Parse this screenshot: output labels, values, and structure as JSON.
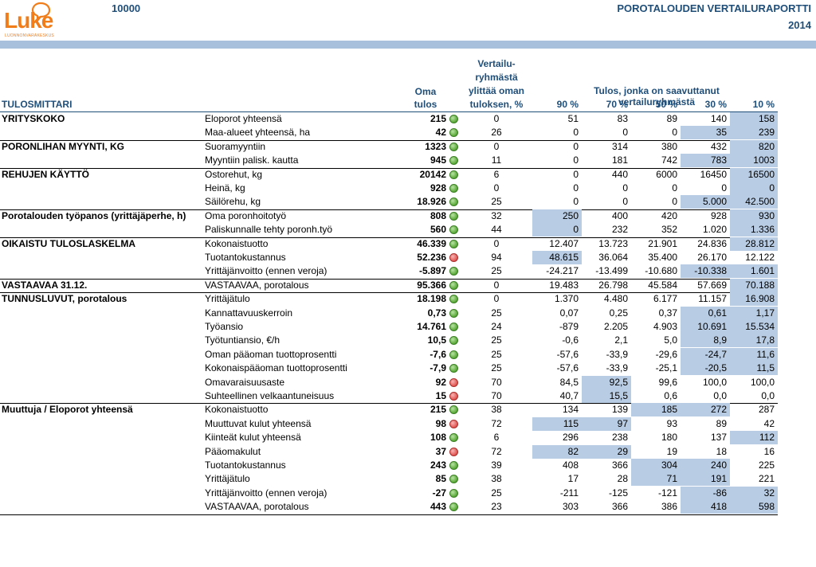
{
  "header": {
    "logo_text": "Luke",
    "logo_sub": "LUONNONVARAKESKUS",
    "report_id": "10000",
    "report_title": "POROTALOUDEN VERTAILURAPORTTI",
    "report_year": "2014"
  },
  "colors": {
    "header_text": "#1f4e79",
    "band": "#a8c0dc",
    "highlight": "#b8cce4",
    "good": "#57a836",
    "bad": "#e2534f",
    "logo": "#f07d1a"
  },
  "columns": {
    "tulosmittari": "TULOSMITTARI",
    "oma_line1": "Oma",
    "oma_line2": "tulos",
    "vert_line1": "Vertailu-",
    "vert_line2": "ryhmästä",
    "vert_line3": "ylittää oman",
    "vert_line4": "tuloksen, %",
    "tulos_group": "Tulos, jonka on saavuttanut vertailuryhmästä",
    "pcts": [
      "90 %",
      "70 %",
      "50 %",
      "30 %",
      "10 %"
    ]
  },
  "rows": [
    {
      "cat": "YRITYSKOKO",
      "name": "Eloporot yhteensä",
      "oma": "215",
      "dot": "green",
      "pct": "0",
      "vals": [
        "51",
        "83",
        "89",
        "140",
        "158"
      ],
      "hl": [
        0,
        0,
        0,
        0,
        1
      ],
      "sep": false
    },
    {
      "cat": "",
      "name": "Maa-alueet yhteensä, ha",
      "oma": "42",
      "dot": "green",
      "pct": "26",
      "vals": [
        "0",
        "0",
        "0",
        "35",
        "239"
      ],
      "hl": [
        0,
        0,
        0,
        1,
        1
      ],
      "sep": true
    },
    {
      "cat": "PORONLIHAN MYYNTI, KG",
      "name": "Suoramyyntiin",
      "oma": "1323",
      "dot": "green",
      "pct": "0",
      "vals": [
        "0",
        "314",
        "380",
        "432",
        "820"
      ],
      "hl": [
        0,
        0,
        0,
        0,
        1
      ],
      "sep": false
    },
    {
      "cat": "",
      "name": "Myyntiin palisk. kautta",
      "oma": "945",
      "dot": "green",
      "pct": "11",
      "vals": [
        "0",
        "181",
        "742",
        "783",
        "1003"
      ],
      "hl": [
        0,
        0,
        0,
        1,
        1
      ],
      "sep": true
    },
    {
      "cat": "REHUJEN KÄYTTÖ",
      "name": "Ostorehut, kg",
      "oma": "20142",
      "dot": "green",
      "pct": "6",
      "vals": [
        "0",
        "440",
        "6000",
        "16450",
        "16500"
      ],
      "hl": [
        0,
        0,
        0,
        0,
        1
      ],
      "sep": false
    },
    {
      "cat": "",
      "name": "Heinä, kg",
      "oma": "928",
      "dot": "green",
      "pct": "0",
      "vals": [
        "0",
        "0",
        "0",
        "0",
        "0"
      ],
      "hl": [
        0,
        0,
        0,
        0,
        1
      ],
      "sep": false
    },
    {
      "cat": "",
      "name": "Säilörehu, kg",
      "oma": "18.926",
      "dot": "green",
      "pct": "25",
      "vals": [
        "0",
        "0",
        "0",
        "5.000",
        "42.500"
      ],
      "hl": [
        0,
        0,
        0,
        1,
        1
      ],
      "sep": true
    },
    {
      "cat": "Porotalouden työpanos (yrittäjäperhe, h)",
      "name": "Oma poronhoitotyö",
      "oma": "808",
      "dot": "green",
      "pct": "32",
      "vals": [
        "250",
        "400",
        "420",
        "928",
        "930"
      ],
      "hl": [
        1,
        0,
        0,
        0,
        1
      ],
      "sep": false
    },
    {
      "cat": "",
      "name": "Paliskunnalle tehty poronh.työ",
      "oma": "560",
      "dot": "green",
      "pct": "44",
      "vals": [
        "0",
        "232",
        "352",
        "1.020",
        "1.336"
      ],
      "hl": [
        1,
        0,
        0,
        0,
        1
      ],
      "sep": true
    },
    {
      "cat": "OIKAISTU TULOSLASKELMA",
      "name": "Kokonaistuotto",
      "oma": "46.339",
      "dot": "green",
      "pct": "0",
      "vals": [
        "12.407",
        "13.723",
        "21.901",
        "24.836",
        "28.812"
      ],
      "hl": [
        0,
        0,
        0,
        0,
        1
      ],
      "sep": false
    },
    {
      "cat": "",
      "name": "Tuotantokustannus",
      "oma": "52.236",
      "dot": "red",
      "pct": "94",
      "vals": [
        "48.615",
        "36.064",
        "35.400",
        "26.170",
        "12.122"
      ],
      "hl": [
        1,
        0,
        0,
        0,
        0
      ],
      "sep": false
    },
    {
      "cat": "",
      "name": "Yrittäjänvoitto (ennen veroja)",
      "oma": "-5.897",
      "dot": "green",
      "pct": "25",
      "vals": [
        "-24.217",
        "-13.499",
        "-10.680",
        "-10.338",
        "1.601"
      ],
      "hl": [
        0,
        0,
        0,
        1,
        1
      ],
      "sep": true
    },
    {
      "cat": "VASTAAVAA 31.12.",
      "name": "VASTAAVAA, porotalous",
      "oma": "95.366",
      "dot": "green",
      "pct": "0",
      "vals": [
        "19.483",
        "26.798",
        "45.584",
        "57.669",
        "70.188"
      ],
      "hl": [
        0,
        0,
        0,
        0,
        1
      ],
      "sep": true
    },
    {
      "cat": "TUNNUSLUVUT, porotalous",
      "name": "Yrittäjätulo",
      "oma": "18.198",
      "dot": "green",
      "pct": "0",
      "vals": [
        "1.370",
        "4.480",
        "6.177",
        "11.157",
        "16.908"
      ],
      "hl": [
        0,
        0,
        0,
        0,
        1
      ],
      "sep": false
    },
    {
      "cat": "",
      "name": "Kannattavuuskerroin",
      "oma": "0,73",
      "dot": "green",
      "pct": "25",
      "vals": [
        "0,07",
        "0,25",
        "0,37",
        "0,61",
        "1,17"
      ],
      "hl": [
        0,
        0,
        0,
        1,
        1
      ],
      "sep": false
    },
    {
      "cat": "",
      "name": "Työansio",
      "oma": "14.761",
      "dot": "green",
      "pct": "24",
      "vals": [
        "-879",
        "2.205",
        "4.903",
        "10.691",
        "15.534"
      ],
      "hl": [
        0,
        0,
        0,
        1,
        1
      ],
      "sep": false
    },
    {
      "cat": "",
      "name": "Työtuntiansio, €/h",
      "oma": "10,5",
      "dot": "green",
      "pct": "25",
      "vals": [
        "-0,6",
        "2,1",
        "5,0",
        "8,9",
        "17,8"
      ],
      "hl": [
        0,
        0,
        0,
        1,
        1
      ],
      "sep": false
    },
    {
      "cat": "",
      "name": "Oman pääoman tuottoprosentti",
      "oma": "-7,6",
      "dot": "green",
      "pct": "25",
      "vals": [
        "-57,6",
        "-33,9",
        "-29,6",
        "-24,7",
        "11,6"
      ],
      "hl": [
        0,
        0,
        0,
        1,
        1
      ],
      "sep": false
    },
    {
      "cat": "",
      "name": "Kokonaispääoman tuottoprosentti",
      "oma": "-7,9",
      "dot": "green",
      "pct": "25",
      "vals": [
        "-57,6",
        "-33,9",
        "-25,1",
        "-20,5",
        "11,5"
      ],
      "hl": [
        0,
        0,
        0,
        1,
        1
      ],
      "sep": false
    },
    {
      "cat": "",
      "name": "Omavaraisuusaste",
      "oma": "92",
      "dot": "red",
      "pct": "70",
      "vals": [
        "84,5",
        "92,5",
        "99,6",
        "100,0",
        "100,0"
      ],
      "hl": [
        0,
        1,
        0,
        0,
        0
      ],
      "sep": false
    },
    {
      "cat": "",
      "name": "Suhteellinen velkaantuneisuus",
      "oma": "15",
      "dot": "red",
      "pct": "70",
      "vals": [
        "40,7",
        "15,5",
        "0,6",
        "0,0",
        "0,0"
      ],
      "hl": [
        0,
        1,
        0,
        0,
        0
      ],
      "sep": true
    },
    {
      "cat": "Muuttuja / Eloporot yhteensä",
      "name": "Kokonaistuotto",
      "oma": "215",
      "dot": "green",
      "pct": "38",
      "vals": [
        "134",
        "139",
        "185",
        "272",
        "287"
      ],
      "hl": [
        0,
        0,
        1,
        1,
        0
      ],
      "sep": false
    },
    {
      "cat": "",
      "name": "Muuttuvat kulut yhteensä",
      "oma": "98",
      "dot": "red",
      "pct": "72",
      "vals": [
        "115",
        "97",
        "93",
        "89",
        "42"
      ],
      "hl": [
        1,
        1,
        0,
        0,
        0
      ],
      "sep": false
    },
    {
      "cat": "",
      "name": "Kiinteät kulut yhteensä",
      "oma": "108",
      "dot": "green",
      "pct": "6",
      "vals": [
        "296",
        "238",
        "180",
        "137",
        "112"
      ],
      "hl": [
        0,
        0,
        0,
        0,
        1
      ],
      "sep": false
    },
    {
      "cat": "",
      "name": "Pääomakulut",
      "oma": "37",
      "dot": "red",
      "pct": "72",
      "vals": [
        "82",
        "29",
        "19",
        "18",
        "16"
      ],
      "hl": [
        1,
        1,
        0,
        0,
        0
      ],
      "sep": false
    },
    {
      "cat": "",
      "name": "Tuotantokustannus",
      "oma": "243",
      "dot": "green",
      "pct": "39",
      "vals": [
        "408",
        "366",
        "304",
        "240",
        "225"
      ],
      "hl": [
        0,
        0,
        1,
        1,
        0
      ],
      "sep": false
    },
    {
      "cat": "",
      "name": "Yrittäjätulo",
      "oma": "85",
      "dot": "green",
      "pct": "38",
      "vals": [
        "17",
        "28",
        "71",
        "191",
        "221"
      ],
      "hl": [
        0,
        0,
        1,
        1,
        0
      ],
      "sep": false
    },
    {
      "cat": "",
      "name": "Yrittäjänvoitto (ennen veroja)",
      "oma": "-27",
      "dot": "green",
      "pct": "25",
      "vals": [
        "-211",
        "-125",
        "-121",
        "-86",
        "32"
      ],
      "hl": [
        0,
        0,
        0,
        1,
        1
      ],
      "sep": false
    },
    {
      "cat": "",
      "name": "VASTAAVAA, porotalous",
      "oma": "443",
      "dot": "green",
      "pct": "23",
      "vals": [
        "303",
        "366",
        "386",
        "418",
        "598"
      ],
      "hl": [
        0,
        0,
        0,
        1,
        1
      ],
      "sep": true
    }
  ]
}
